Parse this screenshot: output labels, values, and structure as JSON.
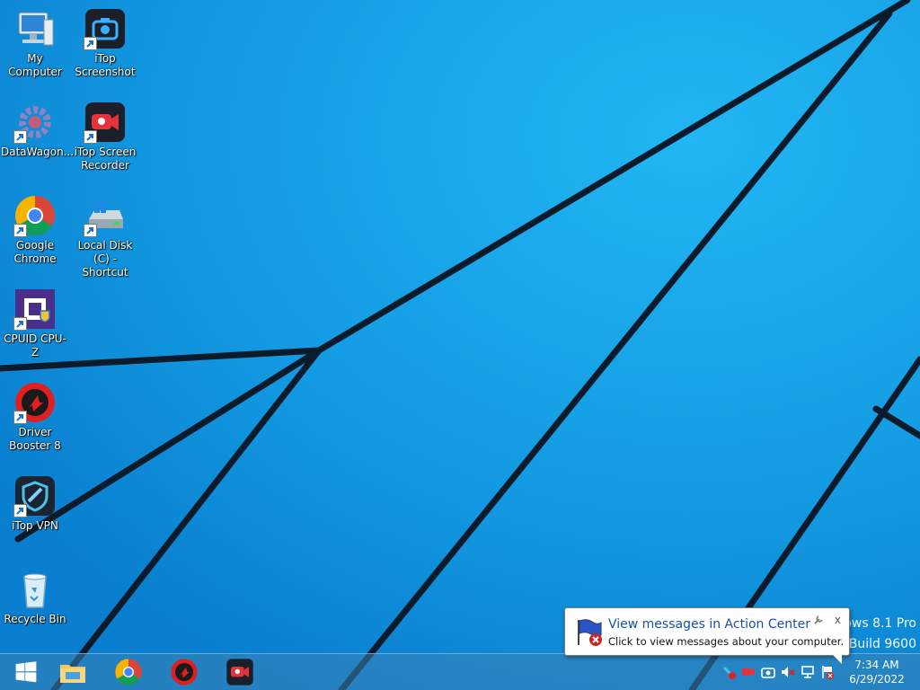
{
  "desktop": {
    "icons": [
      {
        "label": "My Computer"
      },
      {
        "label": "iTop Screenshot"
      },
      {
        "label": "DataWagon..."
      },
      {
        "label": "iTop Screen Recorder"
      },
      {
        "label": "Google Chrome"
      },
      {
        "label": "Local Disk (C) - Shortcut"
      },
      {
        "label": "CPUID CPU-Z"
      },
      {
        "label": "Driver Booster 8"
      },
      {
        "label": "iTop VPN"
      },
      {
        "label": "Recycle Bin"
      }
    ]
  },
  "watermark": {
    "line1": "ows 8.1 Pro",
    "line2": "Build 9600"
  },
  "notification": {
    "title": "View messages in Action Center",
    "body": "Click to view messages about your computer.",
    "close_label": "x"
  },
  "taskbar": {
    "pinned": [
      "start-button",
      "file-explorer",
      "google-chrome",
      "driver-booster",
      "itop-screen-recorder"
    ],
    "clock": {
      "time": "7:34 AM",
      "date": "6/29/2022"
    }
  },
  "colors": {
    "wallpaper": "#1aa0e8",
    "accent": "#1a4fb0"
  }
}
